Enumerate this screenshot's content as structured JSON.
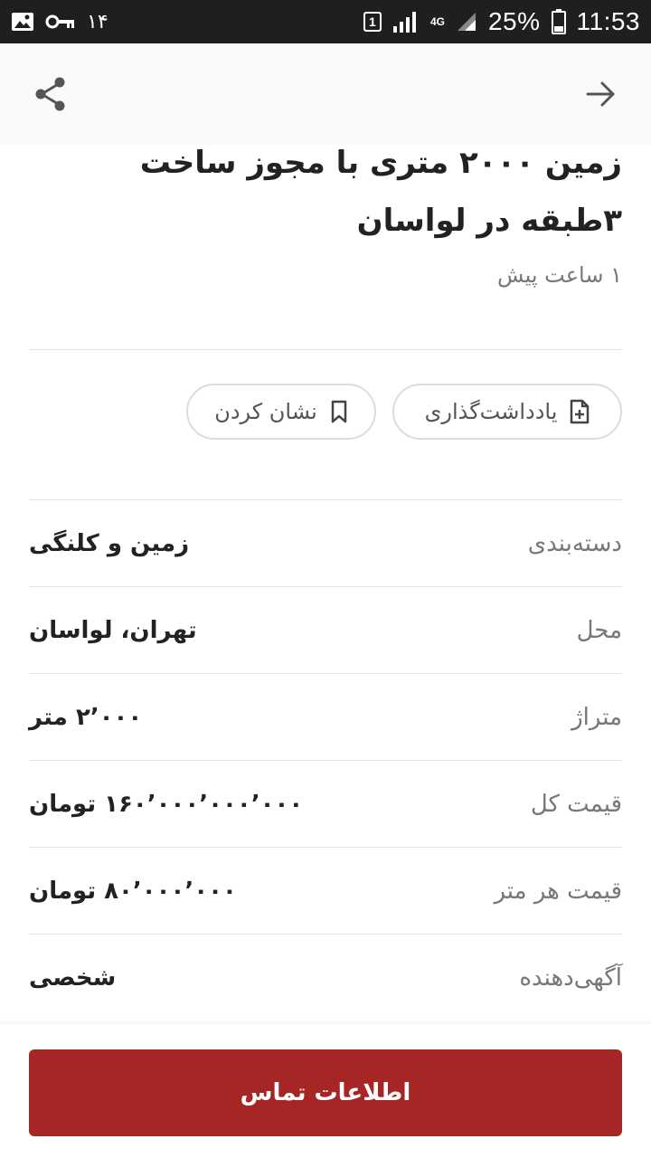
{
  "status_bar": {
    "notification_count": "۱۴",
    "sim_number": "1",
    "network": "4G",
    "battery": "25%",
    "time": "11:53",
    "icons": [
      "image-icon",
      "key-icon",
      "sim-icon",
      "signal-icon",
      "battery-icon"
    ]
  },
  "header": {
    "back_icon": "arrow-right-icon",
    "share_icon": "share-icon"
  },
  "listing": {
    "title": "زمین ۲۰۰۰ متری با مجوز ساخت ۳طبقه در لواسان",
    "time_ago": "۱ ساعت پیش"
  },
  "actions": {
    "note_label": "یادداشت‌گذاری",
    "note_icon": "note-add-icon",
    "bookmark_label": "نشان کردن",
    "bookmark_icon": "bookmark-icon"
  },
  "details": [
    {
      "label": "دسته‌بندی",
      "value": "زمین و کلنگی"
    },
    {
      "label": "محل",
      "value": "تهران، لواسان"
    },
    {
      "label": "متراژ",
      "value": "۲٬۰۰۰ متر"
    },
    {
      "label": "قیمت کل",
      "value": "۱۶۰٬۰۰۰٬۰۰۰٬۰۰۰ تومان"
    },
    {
      "label": "قیمت هر متر",
      "value": "۸۰٬۰۰۰٬۰۰۰ تومان"
    },
    {
      "label": "آگهی‌دهنده",
      "value": "شخصی"
    }
  ],
  "contact_button": {
    "label": "اطلاعات تماس",
    "color": "#a62626"
  }
}
